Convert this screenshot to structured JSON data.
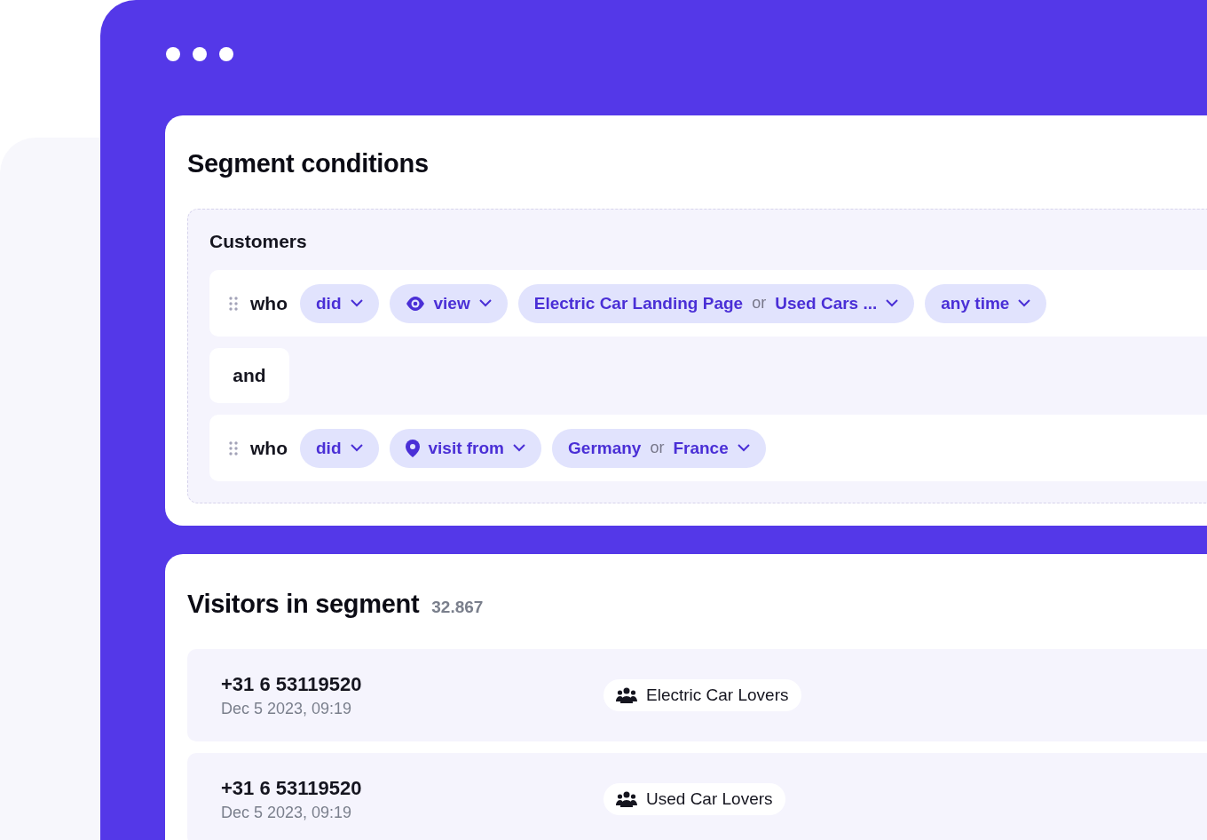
{
  "conditions": {
    "title": "Segment conditions",
    "group_label": "Customers",
    "items": [
      {
        "kind": "rule",
        "subject": "who",
        "chips": [
          {
            "kind": "select",
            "label": "did"
          },
          {
            "kind": "event",
            "label": "view"
          },
          {
            "kind": "values",
            "options": [
              "Electric Car Landing Page",
              "Used Cars ..."
            ],
            "joiner": "or"
          },
          {
            "kind": "select",
            "label": "any time"
          }
        ]
      },
      {
        "kind": "operator",
        "label": "and"
      },
      {
        "kind": "rule",
        "subject": "who",
        "chips": [
          {
            "kind": "select",
            "label": "did"
          },
          {
            "kind": "location",
            "label": "visit from"
          },
          {
            "kind": "values",
            "options": [
              "Germany",
              "France"
            ],
            "joiner": "or"
          }
        ]
      }
    ]
  },
  "visitors": {
    "title": "Visitors in segment",
    "count": "32.867",
    "rows": [
      {
        "phone": "+31 6 53119520",
        "time": "Dec 5 2023, 09:19",
        "segment": "Electric Car Lovers"
      },
      {
        "phone": "+31 6 53119520",
        "time": "Dec 5 2023, 09:19",
        "segment": "Used Car Lovers"
      }
    ]
  }
}
